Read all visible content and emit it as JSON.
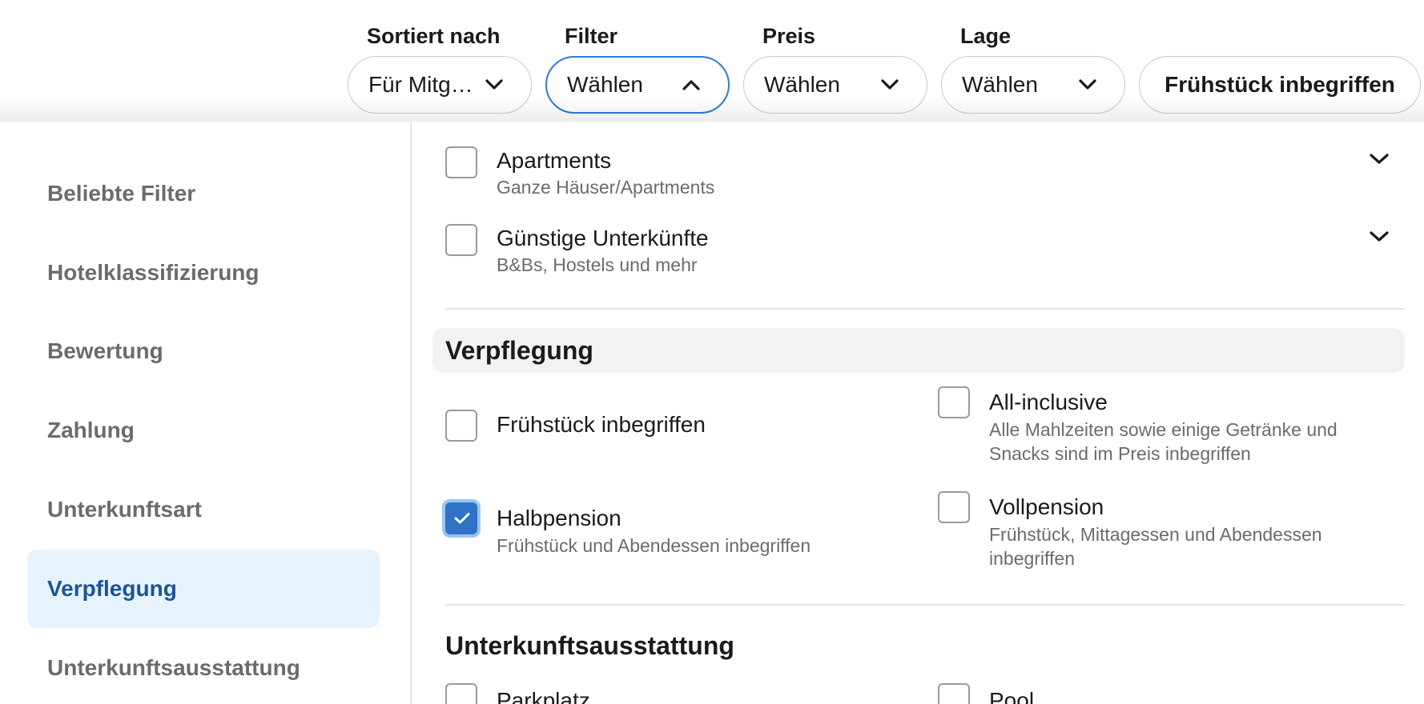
{
  "top_filters": [
    {
      "label": "Sortiert nach",
      "value": "Für Mitg…",
      "icon": "chevron-down-icon"
    },
    {
      "label": "Filter",
      "value": "Wählen",
      "icon": "chevron-up-icon"
    },
    {
      "label": "Preis",
      "value": "Wählen",
      "icon": "chevron-down-icon"
    },
    {
      "label": "Lage",
      "value": "Wählen",
      "icon": "chevron-down-icon"
    }
  ],
  "quick_filter": "Frühstück inbegriffen",
  "sidebar": {
    "items": [
      {
        "label": "Beliebte Filter"
      },
      {
        "label": "Hotelklassifizierung"
      },
      {
        "label": "Bewertung"
      },
      {
        "label": "Zahlung"
      },
      {
        "label": "Unterkunftsart"
      },
      {
        "label": "Verpflegung",
        "active": true
      },
      {
        "label": "Unterkunftsausstattung"
      }
    ]
  },
  "accommodation_types": [
    {
      "title": "Apartments",
      "subtitle": "Ganze Häuser/Apartments",
      "checked": false
    },
    {
      "title": "Günstige Unterkünfte",
      "subtitle": "B&Bs, Hostels und mehr",
      "checked": false
    }
  ],
  "meals": {
    "title": "Verpflegung",
    "options": [
      {
        "title": "Frühstück inbegriffen",
        "subtitle": "",
        "checked": false
      },
      {
        "title": "All-inclusive",
        "subtitle": "Alle Mahlzeiten sowie einige Getränke und Snacks sind im Preis inbegriffen",
        "checked": false
      },
      {
        "title": "Halbpension",
        "subtitle": "Frühstück und Abendessen inbegriffen",
        "checked": true
      },
      {
        "title": "Vollpension",
        "subtitle": "Frühstück, Mittagessen und Abendessen inbegriffen",
        "checked": false
      }
    ]
  },
  "amenities": {
    "title": "Unterkunftsausstattung",
    "options": [
      {
        "title": "Parkplatz",
        "checked": false
      },
      {
        "title": "Pool",
        "checked": false
      }
    ]
  },
  "colors": {
    "accent": "#2f73c6",
    "active_nav_bg": "#e6f3fd",
    "active_nav_text": "#1b5593",
    "section_band": "#f2f2f0"
  }
}
